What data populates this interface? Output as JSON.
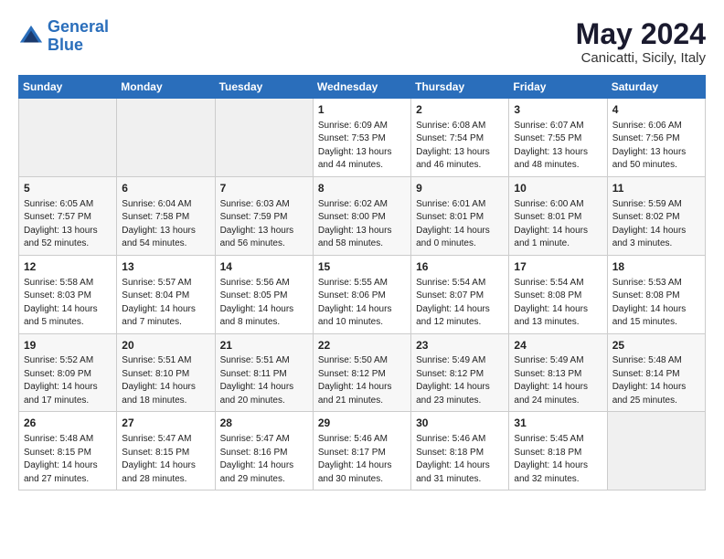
{
  "header": {
    "logo_line1": "General",
    "logo_line2": "Blue",
    "month_title": "May 2024",
    "location": "Canicatti, Sicily, Italy"
  },
  "weekdays": [
    "Sunday",
    "Monday",
    "Tuesday",
    "Wednesday",
    "Thursday",
    "Friday",
    "Saturday"
  ],
  "weeks": [
    [
      {
        "day": "",
        "sunrise": "",
        "sunset": "",
        "daylight": ""
      },
      {
        "day": "",
        "sunrise": "",
        "sunset": "",
        "daylight": ""
      },
      {
        "day": "",
        "sunrise": "",
        "sunset": "",
        "daylight": ""
      },
      {
        "day": "1",
        "sunrise": "6:09 AM",
        "sunset": "7:53 PM",
        "daylight": "13 hours and 44 minutes."
      },
      {
        "day": "2",
        "sunrise": "6:08 AM",
        "sunset": "7:54 PM",
        "daylight": "13 hours and 46 minutes."
      },
      {
        "day": "3",
        "sunrise": "6:07 AM",
        "sunset": "7:55 PM",
        "daylight": "13 hours and 48 minutes."
      },
      {
        "day": "4",
        "sunrise": "6:06 AM",
        "sunset": "7:56 PM",
        "daylight": "13 hours and 50 minutes."
      }
    ],
    [
      {
        "day": "5",
        "sunrise": "6:05 AM",
        "sunset": "7:57 PM",
        "daylight": "13 hours and 52 minutes."
      },
      {
        "day": "6",
        "sunrise": "6:04 AM",
        "sunset": "7:58 PM",
        "daylight": "13 hours and 54 minutes."
      },
      {
        "day": "7",
        "sunrise": "6:03 AM",
        "sunset": "7:59 PM",
        "daylight": "13 hours and 56 minutes."
      },
      {
        "day": "8",
        "sunrise": "6:02 AM",
        "sunset": "8:00 PM",
        "daylight": "13 hours and 58 minutes."
      },
      {
        "day": "9",
        "sunrise": "6:01 AM",
        "sunset": "8:01 PM",
        "daylight": "14 hours and 0 minutes."
      },
      {
        "day": "10",
        "sunrise": "6:00 AM",
        "sunset": "8:01 PM",
        "daylight": "14 hours and 1 minute."
      },
      {
        "day": "11",
        "sunrise": "5:59 AM",
        "sunset": "8:02 PM",
        "daylight": "14 hours and 3 minutes."
      }
    ],
    [
      {
        "day": "12",
        "sunrise": "5:58 AM",
        "sunset": "8:03 PM",
        "daylight": "14 hours and 5 minutes."
      },
      {
        "day": "13",
        "sunrise": "5:57 AM",
        "sunset": "8:04 PM",
        "daylight": "14 hours and 7 minutes."
      },
      {
        "day": "14",
        "sunrise": "5:56 AM",
        "sunset": "8:05 PM",
        "daylight": "14 hours and 8 minutes."
      },
      {
        "day": "15",
        "sunrise": "5:55 AM",
        "sunset": "8:06 PM",
        "daylight": "14 hours and 10 minutes."
      },
      {
        "day": "16",
        "sunrise": "5:54 AM",
        "sunset": "8:07 PM",
        "daylight": "14 hours and 12 minutes."
      },
      {
        "day": "17",
        "sunrise": "5:54 AM",
        "sunset": "8:08 PM",
        "daylight": "14 hours and 13 minutes."
      },
      {
        "day": "18",
        "sunrise": "5:53 AM",
        "sunset": "8:08 PM",
        "daylight": "14 hours and 15 minutes."
      }
    ],
    [
      {
        "day": "19",
        "sunrise": "5:52 AM",
        "sunset": "8:09 PM",
        "daylight": "14 hours and 17 minutes."
      },
      {
        "day": "20",
        "sunrise": "5:51 AM",
        "sunset": "8:10 PM",
        "daylight": "14 hours and 18 minutes."
      },
      {
        "day": "21",
        "sunrise": "5:51 AM",
        "sunset": "8:11 PM",
        "daylight": "14 hours and 20 minutes."
      },
      {
        "day": "22",
        "sunrise": "5:50 AM",
        "sunset": "8:12 PM",
        "daylight": "14 hours and 21 minutes."
      },
      {
        "day": "23",
        "sunrise": "5:49 AM",
        "sunset": "8:12 PM",
        "daylight": "14 hours and 23 minutes."
      },
      {
        "day": "24",
        "sunrise": "5:49 AM",
        "sunset": "8:13 PM",
        "daylight": "14 hours and 24 minutes."
      },
      {
        "day": "25",
        "sunrise": "5:48 AM",
        "sunset": "8:14 PM",
        "daylight": "14 hours and 25 minutes."
      }
    ],
    [
      {
        "day": "26",
        "sunrise": "5:48 AM",
        "sunset": "8:15 PM",
        "daylight": "14 hours and 27 minutes."
      },
      {
        "day": "27",
        "sunrise": "5:47 AM",
        "sunset": "8:15 PM",
        "daylight": "14 hours and 28 minutes."
      },
      {
        "day": "28",
        "sunrise": "5:47 AM",
        "sunset": "8:16 PM",
        "daylight": "14 hours and 29 minutes."
      },
      {
        "day": "29",
        "sunrise": "5:46 AM",
        "sunset": "8:17 PM",
        "daylight": "14 hours and 30 minutes."
      },
      {
        "day": "30",
        "sunrise": "5:46 AM",
        "sunset": "8:18 PM",
        "daylight": "14 hours and 31 minutes."
      },
      {
        "day": "31",
        "sunrise": "5:45 AM",
        "sunset": "8:18 PM",
        "daylight": "14 hours and 32 minutes."
      },
      {
        "day": "",
        "sunrise": "",
        "sunset": "",
        "daylight": ""
      }
    ]
  ]
}
